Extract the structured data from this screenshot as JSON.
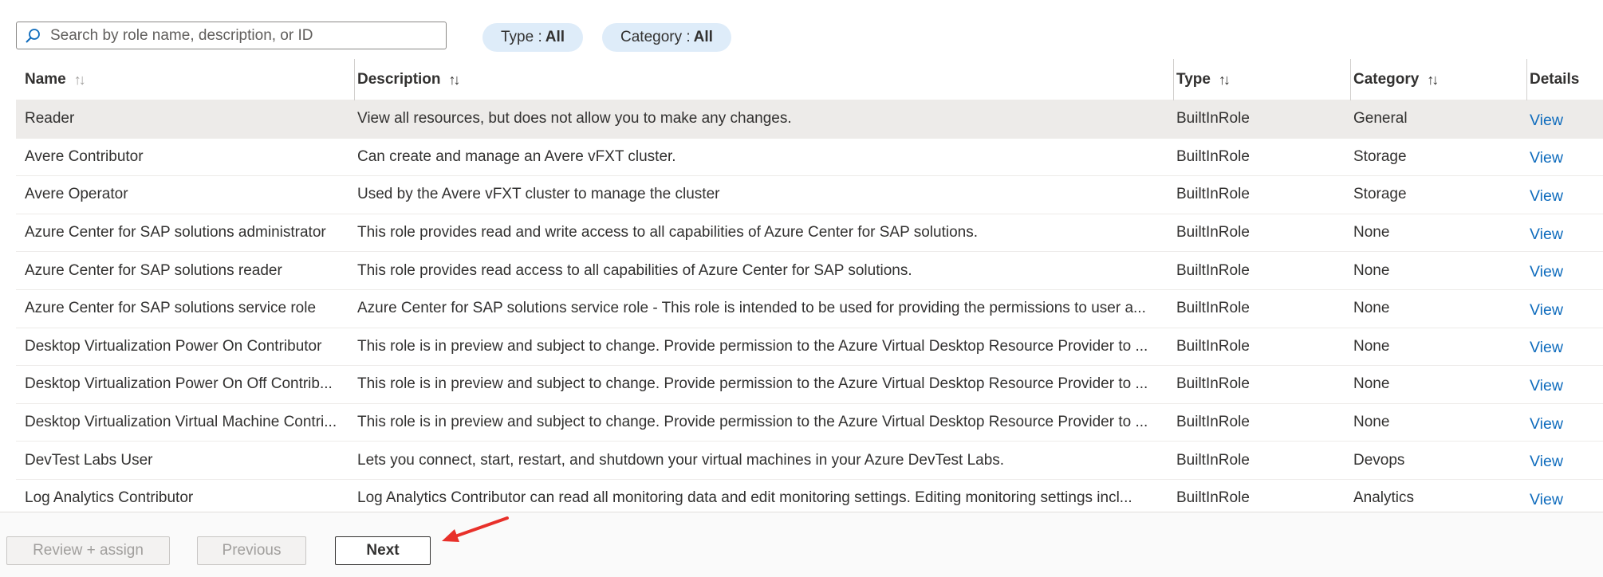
{
  "search": {
    "placeholder": "Search by role name, description, or ID",
    "value": ""
  },
  "filters": [
    {
      "label": "Type",
      "value": "All"
    },
    {
      "label": "Category",
      "value": "All"
    }
  ],
  "columns": {
    "name": "Name",
    "description": "Description",
    "type": "Type",
    "category": "Category",
    "details": "Details"
  },
  "rows": [
    {
      "name": "Reader",
      "description": "View all resources, but does not allow you to make any changes.",
      "type": "BuiltInRole",
      "category": "General",
      "details": "View"
    },
    {
      "name": "Avere Contributor",
      "description": "Can create and manage an Avere vFXT cluster.",
      "type": "BuiltInRole",
      "category": "Storage",
      "details": "View"
    },
    {
      "name": "Avere Operator",
      "description": "Used by the Avere vFXT cluster to manage the cluster",
      "type": "BuiltInRole",
      "category": "Storage",
      "details": "View"
    },
    {
      "name": "Azure Center for SAP solutions administrator",
      "description": "This role provides read and write access to all capabilities of Azure Center for SAP solutions.",
      "type": "BuiltInRole",
      "category": "None",
      "details": "View"
    },
    {
      "name": "Azure Center for SAP solutions reader",
      "description": "This role provides read access to all capabilities of Azure Center for SAP solutions.",
      "type": "BuiltInRole",
      "category": "None",
      "details": "View"
    },
    {
      "name": "Azure Center for SAP solutions service role",
      "description": "Azure Center for SAP solutions service role - This role is intended to be used for providing the permissions to user a...",
      "type": "BuiltInRole",
      "category": "None",
      "details": "View"
    },
    {
      "name": "Desktop Virtualization Power On Contributor",
      "description": "This role is in preview and subject to change. Provide permission to the Azure Virtual Desktop Resource Provider to ...",
      "type": "BuiltInRole",
      "category": "None",
      "details": "View"
    },
    {
      "name": "Desktop Virtualization Power On Off Contrib...",
      "description": "This role is in preview and subject to change. Provide permission to the Azure Virtual Desktop Resource Provider to ...",
      "type": "BuiltInRole",
      "category": "None",
      "details": "View"
    },
    {
      "name": "Desktop Virtualization Virtual Machine Contri...",
      "description": "This role is in preview and subject to change. Provide permission to the Azure Virtual Desktop Resource Provider to ...",
      "type": "BuiltInRole",
      "category": "None",
      "details": "View"
    },
    {
      "name": "DevTest Labs User",
      "description": "Lets you connect, start, restart, and shutdown your virtual machines in your Azure DevTest Labs.",
      "type": "BuiltInRole",
      "category": "Devops",
      "details": "View"
    },
    {
      "name": "Log Analytics Contributor",
      "description": "Log Analytics Contributor can read all monitoring data and edit monitoring settings. Editing monitoring settings incl...",
      "type": "BuiltInRole",
      "category": "Analytics",
      "details": "View"
    }
  ],
  "footer": {
    "review_assign": "Review + assign",
    "previous": "Previous",
    "next": "Next"
  },
  "colors": {
    "link": "#0f6cbd",
    "pill_bg": "#deecf9",
    "selected_row": "#edebe9",
    "arrow": "#e8302a"
  },
  "icons": {
    "search": "search-icon",
    "sort": "sort-icon",
    "annotation": "red-arrow-icon"
  }
}
